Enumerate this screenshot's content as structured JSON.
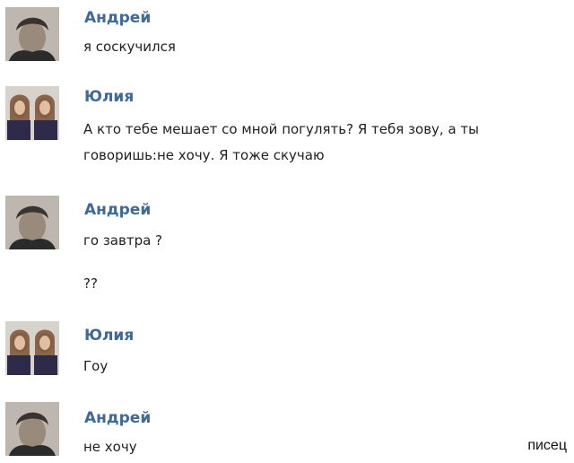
{
  "messages": [
    {
      "author": "Андрей",
      "avatar": "andrey-avatar",
      "lines": [
        "я соскучился"
      ]
    },
    {
      "author": "Юлия",
      "avatar": "yulia-avatar",
      "lines": [
        "А кто тебе мешает со мной погулять? Я тебя зову, а ты",
        "говоришь:не хочу. Я тоже скучаю"
      ]
    },
    {
      "author": "Андрей",
      "avatar": "andrey-avatar",
      "lines": [
        "го завтра ?",
        "??"
      ]
    },
    {
      "author": "Юлия",
      "avatar": "yulia-avatar",
      "lines": [
        "Гоу"
      ]
    },
    {
      "author": "Андрей",
      "avatar": "andrey-avatar",
      "lines": [
        "не хочу"
      ]
    }
  ],
  "watermark": "писец",
  "colors": {
    "author": "#3f6a96",
    "text": "#1f1f1f",
    "background": "#ffffff"
  }
}
